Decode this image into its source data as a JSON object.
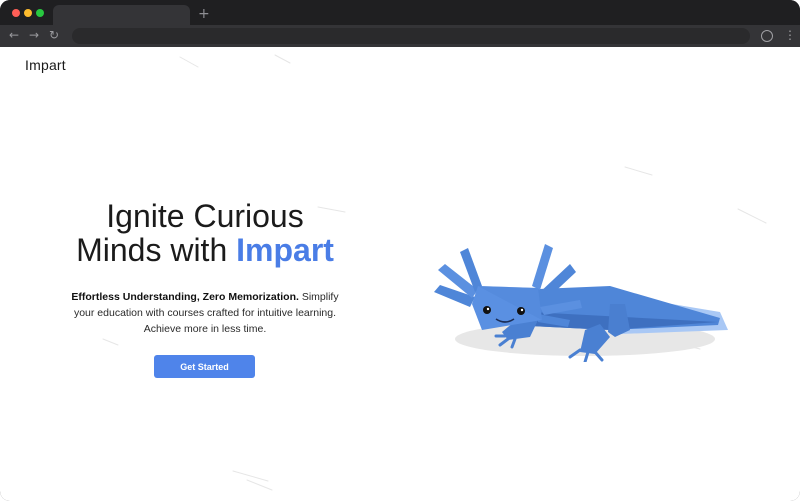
{
  "browser": {
    "new_tab_symbol": "+",
    "back_icon": "back-arrow-icon",
    "forward_icon": "forward-arrow-icon",
    "reload_icon": "reload-icon",
    "profile_icon": "profile-icon",
    "menu_icon": "more-vertical-icon"
  },
  "header": {
    "brand": "Impart"
  },
  "hero": {
    "title_line1": "Ignite Curious",
    "title_line2_prefix": "Minds with ",
    "title_accent": "Impart",
    "description_bold": "Effortless Understanding, Zero Memorization.",
    "description_rest": " Simplify your education with courses crafted for intuitive learning. Achieve more in less time.",
    "cta_label": "Get Started"
  },
  "colors": {
    "accent": "#4a7de6",
    "button": "#4f84ea",
    "axolotl_body": "#4f86d8"
  }
}
